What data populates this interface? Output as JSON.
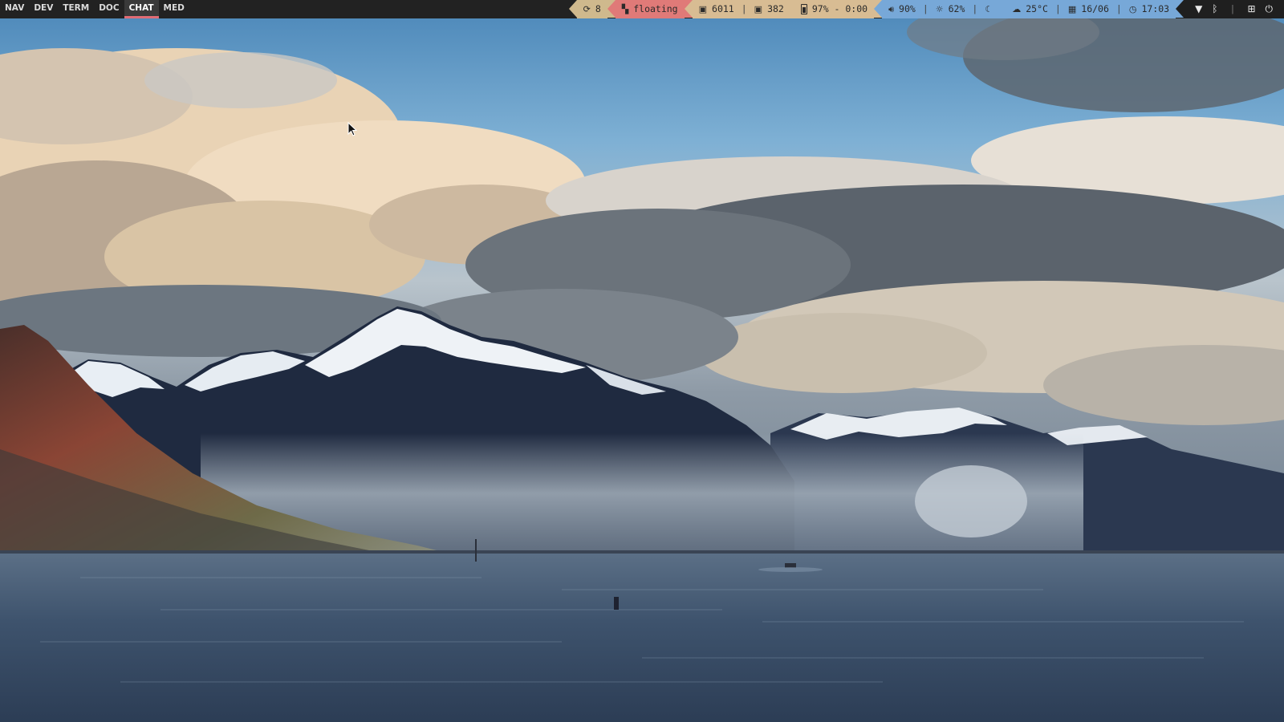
{
  "workspaces": [
    {
      "label": "NAV",
      "active": false
    },
    {
      "label": "DEV",
      "active": false
    },
    {
      "label": "TERM",
      "active": false
    },
    {
      "label": "DOC",
      "active": false
    },
    {
      "label": "CHAT",
      "active": true
    },
    {
      "label": "MED",
      "active": false
    }
  ],
  "status": {
    "updates": {
      "icon": "refresh-icon",
      "value": "8"
    },
    "layout": {
      "icon": "window-icon",
      "value": "floating"
    },
    "memory": {
      "icon": "memory-icon",
      "value": "6011"
    },
    "swap": {
      "icon": "memory-icon",
      "value": "382"
    },
    "battery": {
      "icon": "battery-icon",
      "value": "97% - 0:00"
    },
    "volume": {
      "icon": "speaker-icon",
      "value": "90%"
    },
    "brightness": {
      "icon": "sun-icon",
      "value": "62%"
    },
    "nightmode": {
      "icon": "moon-icon"
    },
    "weather": {
      "icon": "cloud-icon",
      "value": "25°C"
    },
    "date": {
      "icon": "calendar-icon",
      "value": "16/06"
    },
    "time": {
      "icon": "clock-icon",
      "value": "17:03"
    }
  },
  "tray": [
    {
      "icon": "wifi-icon"
    },
    {
      "icon": "bluetooth-icon"
    },
    {
      "icon": "plus-icon"
    },
    {
      "icon": "power-icon"
    }
  ],
  "colors": {
    "bar_bg": "#222222",
    "active_underline": "#e06c75",
    "updates": "#cfb98d",
    "layout": "#e07a78",
    "memory": "#d8bc93",
    "media": "#77a8d8",
    "weather": "#6d9fd3"
  }
}
